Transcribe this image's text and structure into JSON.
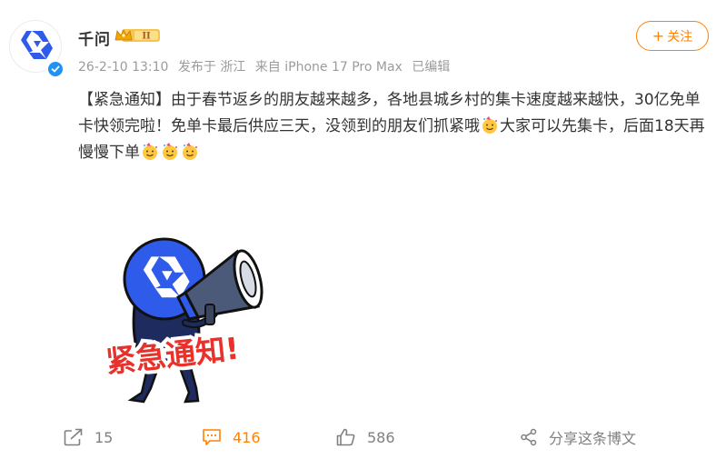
{
  "author": {
    "name": "千问",
    "vip_level": "II",
    "avatar_icon": "qwen-logo-icon",
    "verified_icon": "verified-check-icon"
  },
  "post_meta": {
    "date": "26-2-10 13:10",
    "location": "发布于 浙江",
    "device": "来自 iPhone 17 Pro Max",
    "edited": "已编辑"
  },
  "follow_button": {
    "icon": "+",
    "label": "关注"
  },
  "content": {
    "part1": "【紧急通知】由于春节返乡的朋友越来越多，各地县城乡村的集卡速度越来越快，30亿免单卡快领完啦！免单卡最后供应三天，没领到的朋友们抓紧哦",
    "part2": "大家可以先集卡，后面18天再慢慢下单",
    "emoji_icon": "party-face-emoji"
  },
  "image": {
    "caption": "紧急通知!",
    "icon": "megaphone-mascot-icon"
  },
  "actions": {
    "repost_count": "15",
    "comment_count": "416",
    "like_count": "586",
    "share_label": "分享这条博文"
  },
  "colors": {
    "accent": "#ff8200",
    "brand_blue": "#2f5bea",
    "muted": "#9b9b9b"
  }
}
